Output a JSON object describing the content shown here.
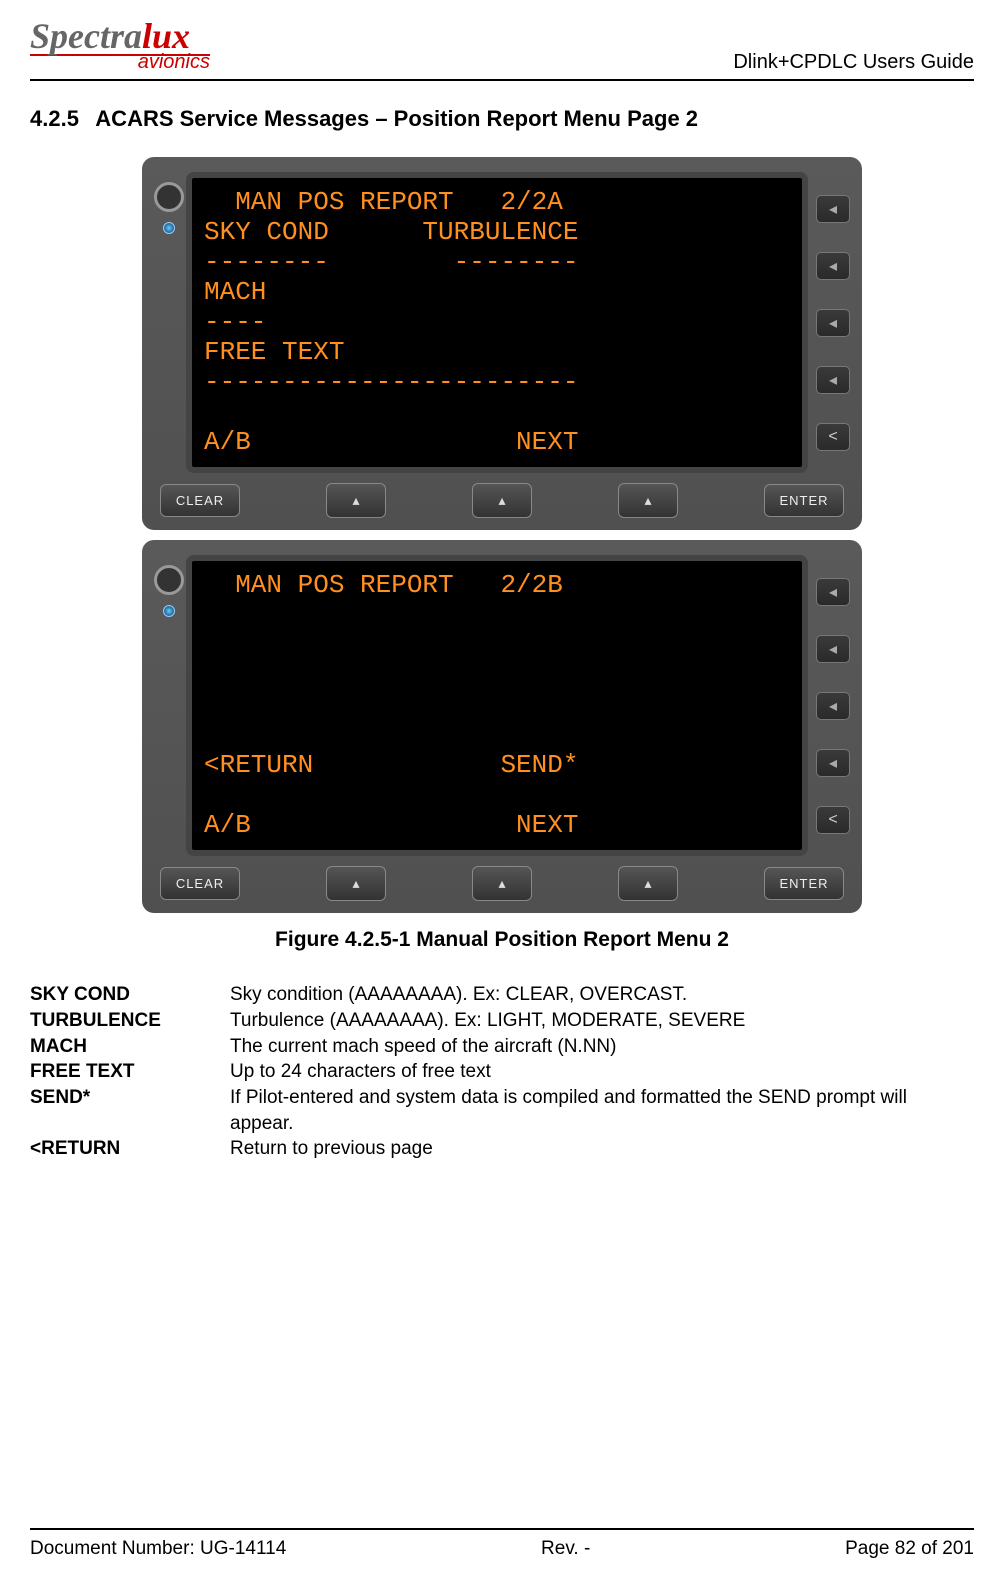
{
  "header": {
    "logo_main_1": "Spectra",
    "logo_main_2": "lux",
    "logo_sub": "avionics",
    "guide_title": "Dlink+CPDLC Users Guide"
  },
  "section": {
    "number": "4.2.5",
    "title": "ACARS Service Messages – Position Report Menu Page 2"
  },
  "cdu_a": {
    "line1": "  MAN POS REPORT   2/2A",
    "line2": "SKY COND      TURBULENCE",
    "line3": "--------        --------",
    "line4": "MACH",
    "line5": "----",
    "line6": "FREE TEXT",
    "line7": "------------------------",
    "line8": "",
    "line9": "A/B                 NEXT"
  },
  "cdu_b": {
    "line1": "  MAN POS REPORT   2/2B",
    "line2": "",
    "line3": "",
    "line4": "",
    "line5": "",
    "line6": "",
    "line7": "<RETURN            SEND*",
    "line8": "",
    "line9": "A/B                 NEXT"
  },
  "buttons": {
    "clear": "CLEAR",
    "enter": "ENTER"
  },
  "figure_caption": "Figure 4.2.5-1 Manual Position Report Menu 2",
  "definitions": [
    {
      "term": "SKY COND",
      "desc": "Sky condition (AAAAAAAA).  Ex: CLEAR, OVERCAST."
    },
    {
      "term": "TURBULENCE",
      "desc": "Turbulence (AAAAAAAA). Ex: LIGHT, MODERATE, SEVERE"
    },
    {
      "term": "MACH",
      "desc": "The current mach speed of the aircraft (N.NN)"
    },
    {
      "term": "FREE TEXT",
      "desc": "Up to 24 characters of free text"
    },
    {
      "term": "SEND*",
      "desc": "If Pilot-entered and system data is compiled and formatted the SEND prompt will appear."
    },
    {
      "term": "<RETURN",
      "desc": "Return to previous page"
    }
  ],
  "footer": {
    "doc": "Document Number:  UG-14114",
    "rev": "Rev. -",
    "page": "Page 82 of 201"
  }
}
